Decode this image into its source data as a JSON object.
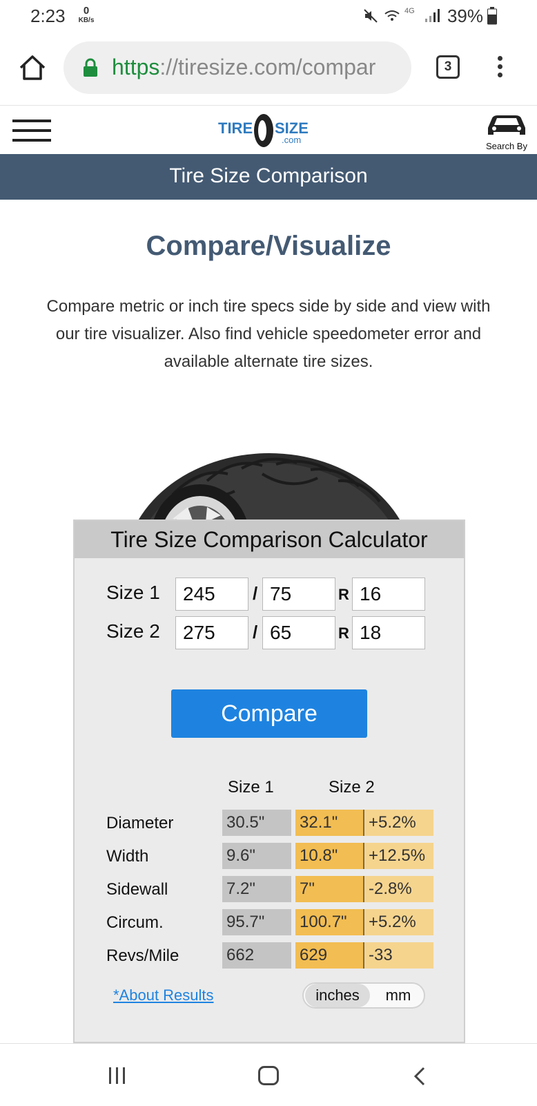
{
  "status_bar": {
    "time": "2:23",
    "net_speed_value": "0",
    "net_speed_unit": "KB/s",
    "network": "4G",
    "battery": "39%"
  },
  "browser": {
    "url_scheme": "https",
    "url_rest": "://tiresize.com/compar",
    "tab_count": "3"
  },
  "site_nav": {
    "search_by_label": "Search By"
  },
  "banner": {
    "title": "Tire Size Comparison"
  },
  "main": {
    "heading": "Compare/Visualize",
    "intro": "Compare metric or inch tire specs side by side and view with our tire visualizer. Also find vehicle speedometer error and available alternate tire sizes."
  },
  "calculator": {
    "title": "Tire Size Comparison Calculator",
    "sizes": [
      {
        "label": "Size 1",
        "width": "245",
        "aspect": "75",
        "rim": "16"
      },
      {
        "label": "Size 2",
        "width": "275",
        "aspect": "65",
        "rim": "18"
      }
    ],
    "separator": "/",
    "construction": "R",
    "compare_label": "Compare",
    "col_size1": "Size 1",
    "col_size2": "Size 2",
    "results": [
      {
        "label": "Diameter",
        "size1": "30.5\"",
        "size2": "32.1\"",
        "diff": "+5.2%"
      },
      {
        "label": "Width",
        "size1": "9.6\"",
        "size2": "10.8\"",
        "diff": "+12.5%"
      },
      {
        "label": "Sidewall",
        "size1": "7.2\"",
        "size2": "7\"",
        "diff": "-2.8%"
      },
      {
        "label": "Circum.",
        "size1": "95.7\"",
        "size2": "100.7\"",
        "diff": "+5.2%"
      },
      {
        "label": "Revs/Mile",
        "size1": "662",
        "size2": "629",
        "diff": "-33"
      }
    ],
    "about_link": "*About Results",
    "unit_options": [
      "inches",
      "mm"
    ],
    "selected_unit": "inches"
  },
  "colors": {
    "banner": "#445a73",
    "button": "#1e83e0",
    "size1_cell": "#c4c4c4",
    "size2_cell": "#f2bd52",
    "diff_cell": "#f5d48e"
  }
}
